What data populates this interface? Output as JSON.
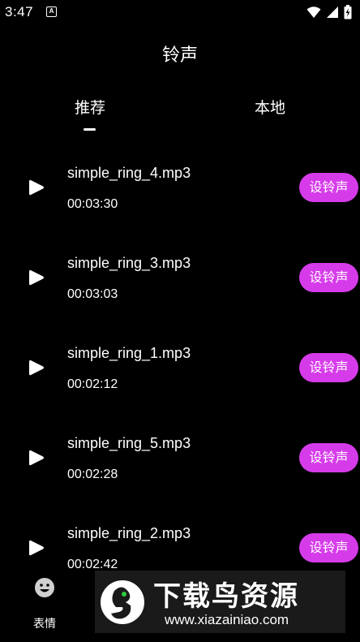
{
  "status_bar": {
    "time": "3:47",
    "notification_glyph": "A"
  },
  "header": {
    "title": "铃声"
  },
  "tabs": [
    {
      "label": "推荐",
      "selected": true
    },
    {
      "label": "本地",
      "selected": false
    }
  ],
  "ringtones": [
    {
      "name": "simple_ring_4.mp3",
      "duration": "00:03:30",
      "action_label": "设铃声"
    },
    {
      "name": "simple_ring_3.mp3",
      "duration": "00:03:03",
      "action_label": "设铃声"
    },
    {
      "name": "simple_ring_1.mp3",
      "duration": "00:02:12",
      "action_label": "设铃声"
    },
    {
      "name": "simple_ring_5.mp3",
      "duration": "00:02:28",
      "action_label": "设铃声"
    },
    {
      "name": "simple_ring_2.mp3",
      "duration": "00:02:42",
      "action_label": "设铃声"
    }
  ],
  "bottom_nav": {
    "emoji_label": "表情"
  },
  "watermark": {
    "brand": "下载鸟资源",
    "url": "www.xiazainiao.com"
  },
  "colors": {
    "background": "#000000",
    "accent": "#d63bea",
    "text": "#ffffff"
  }
}
